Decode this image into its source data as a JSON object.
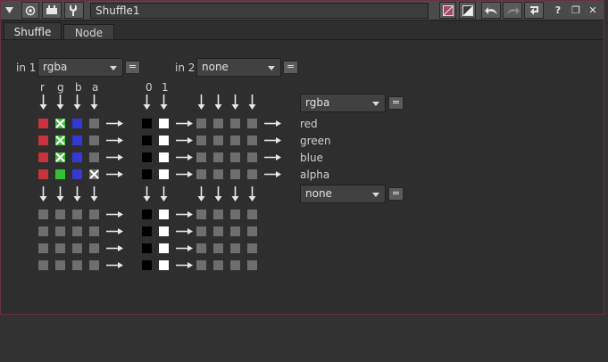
{
  "window": {
    "node_name": "Shuffle1",
    "toolbar_icons": [
      "collapse-arrow-icon",
      "viewer-icon",
      "node-icon",
      "wrench-icon"
    ],
    "right_icons": [
      "color-swatch-icon",
      "split-color-icon",
      "undo-icon",
      "redo-icon",
      "revert-icon",
      "help-icon",
      "float-icon",
      "close-icon"
    ],
    "help_label": "?",
    "float_label": "❐",
    "close_label": "✕"
  },
  "tabs": [
    {
      "label": "Shuffle",
      "active": true
    },
    {
      "label": "Node",
      "active": false
    }
  ],
  "inputs": {
    "in1": {
      "label": "in 1",
      "value": "rgba"
    },
    "in2": {
      "label": "in 2",
      "value": "none"
    },
    "eq_label": "="
  },
  "column_labels": {
    "in1": [
      "r",
      "g",
      "b",
      "a"
    ],
    "in2": [
      "0",
      "1"
    ]
  },
  "outputs": {
    "out1": {
      "value": "rgba",
      "channels": [
        "red",
        "green",
        "blue",
        "alpha"
      ]
    },
    "out2": {
      "value": "none"
    }
  },
  "colors": {
    "red": "#c8333b",
    "green": "#35c033",
    "blue": "#3539d3",
    "gray": "#6e6e6e",
    "accent_border": "#6b2f3c"
  }
}
